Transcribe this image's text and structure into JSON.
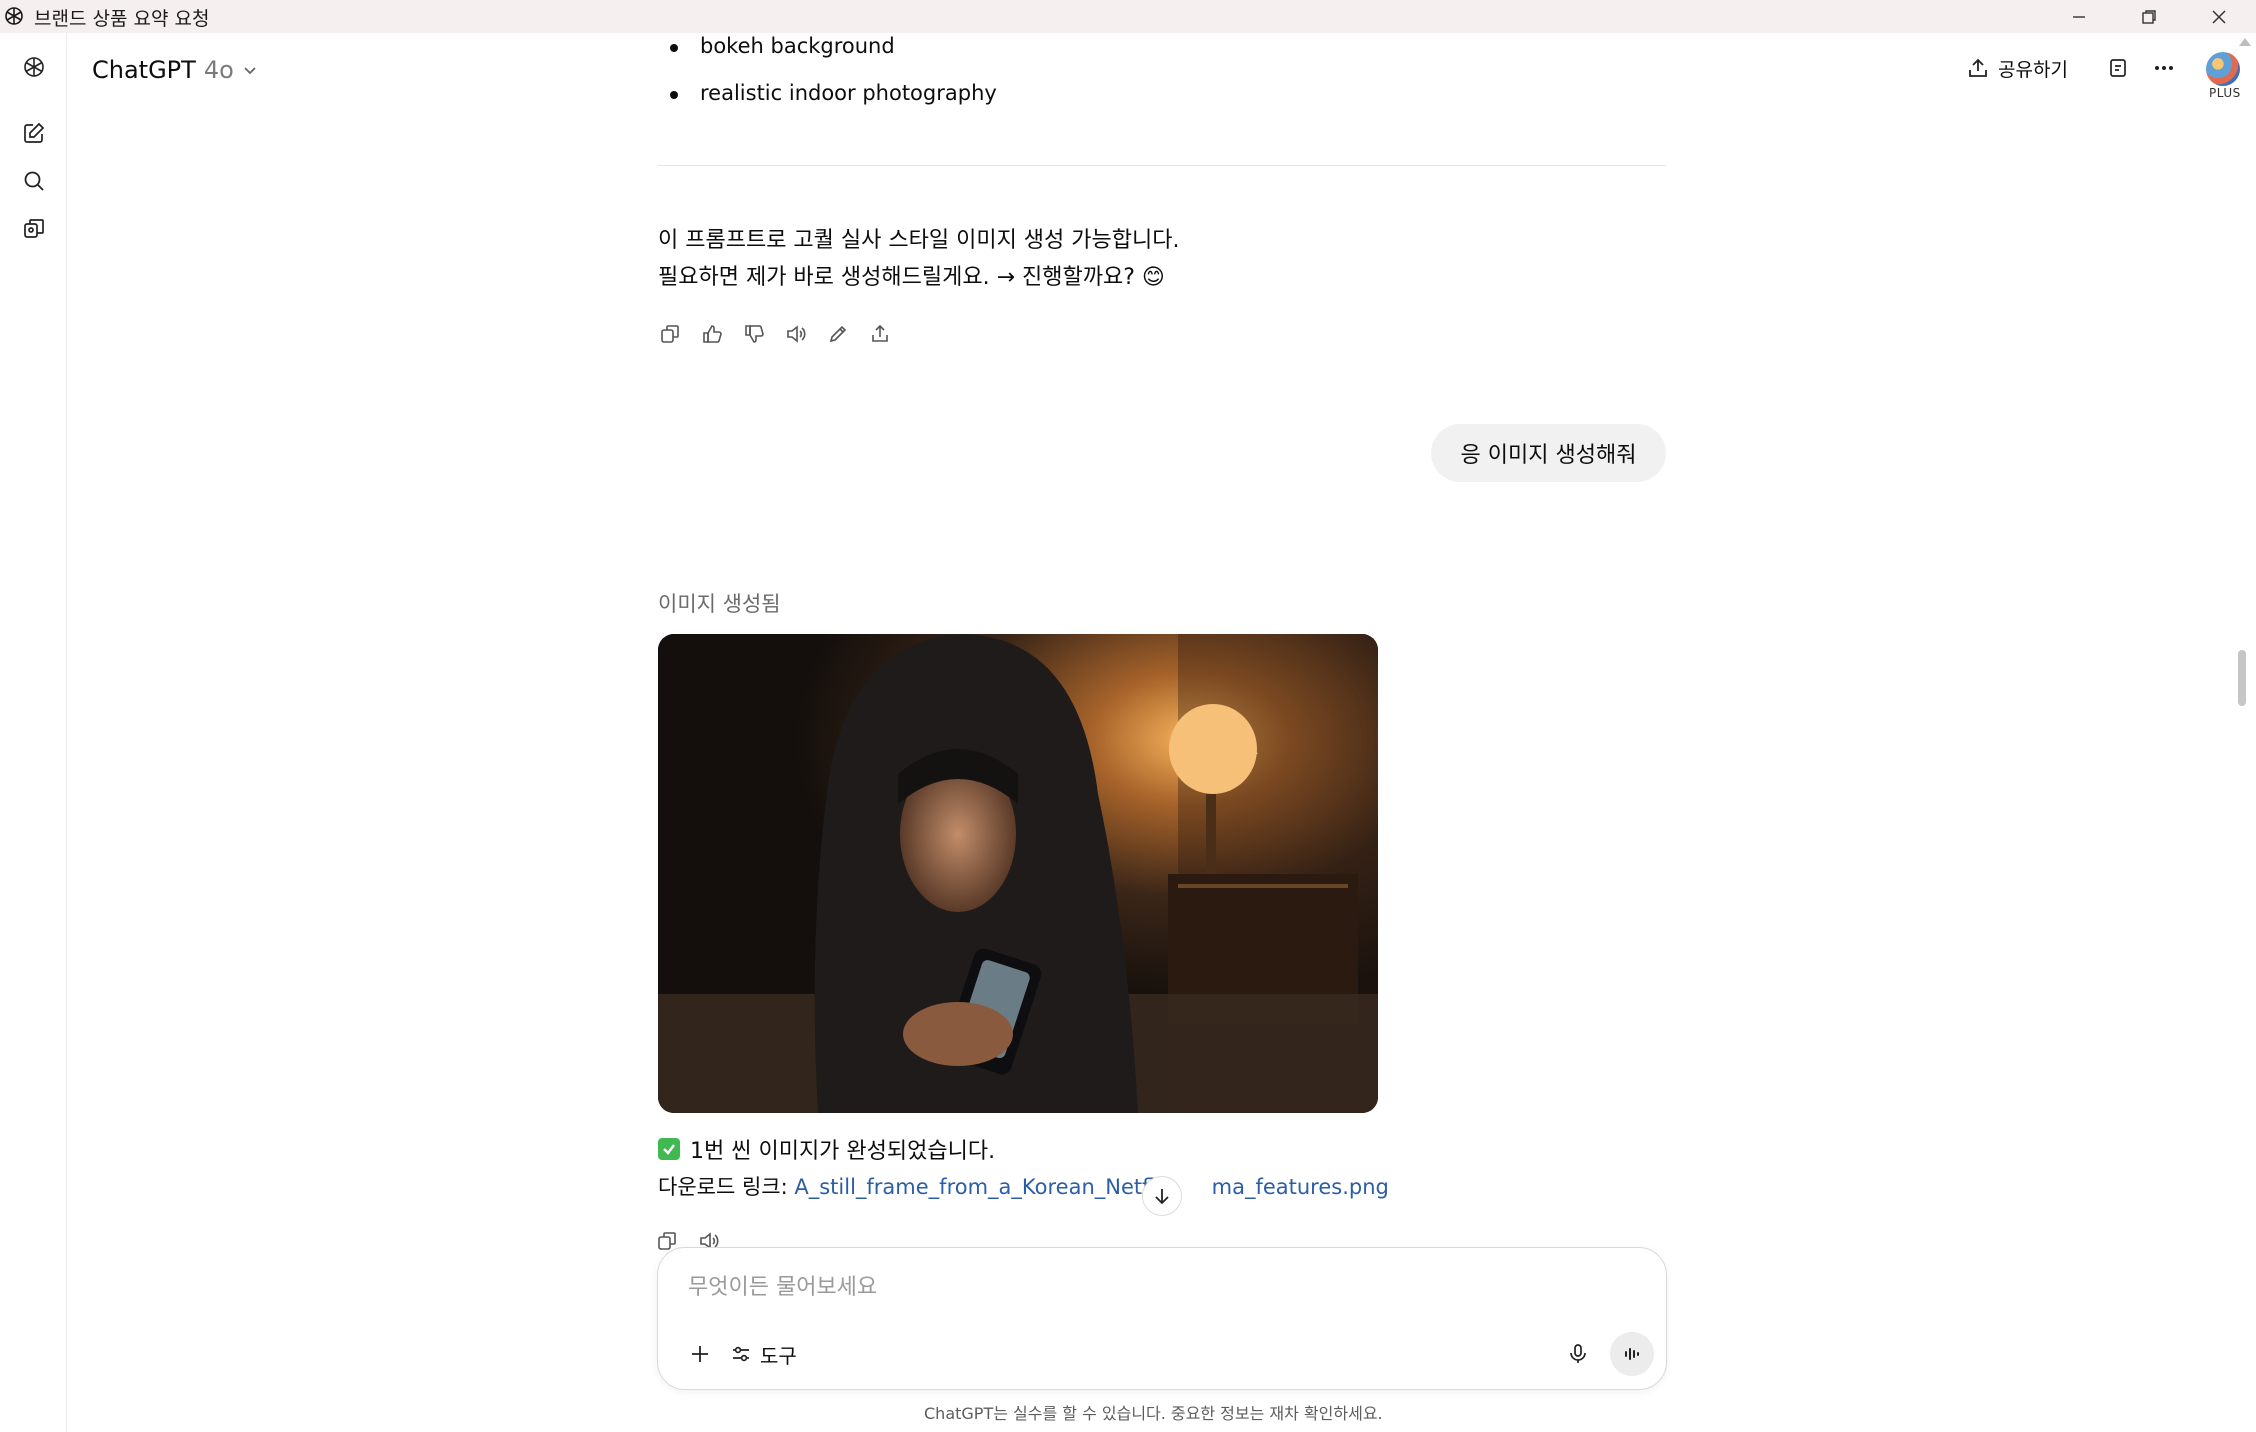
{
  "window": {
    "title": "브랜드 상품 요약 요청",
    "icons": [
      "chatgpt-logo-icon",
      "minimize-icon",
      "maximize-icon",
      "close-icon"
    ]
  },
  "sidebar": {
    "icons": [
      "chatgpt-logo-icon",
      "new-chat-icon",
      "search-icon",
      "library-icon"
    ]
  },
  "header": {
    "model_name": "ChatGPT",
    "model_version": "4o",
    "share_label": "공유하기",
    "plan_badge": "PLUS"
  },
  "conversation": {
    "bullets": [
      "bokeh background",
      "realistic indoor photography"
    ],
    "assistant_line1": "이 프롬프트로 고퀄 실사 스타일 이미지 생성 가능합니다.",
    "assistant_line2": "필요하면 제가 바로 생성해드릴게요. → 진행할까요? 😊",
    "action_icons": [
      "copy-icon",
      "thumbs-up-icon",
      "thumbs-down-icon",
      "read-aloud-icon",
      "edit-icon",
      "share-icon"
    ],
    "user_message": "응 이미지 생성해줘",
    "image_caption": "이미지 생성됨",
    "done_text": "1번 씬 이미지가 완성되었습니다.",
    "download_prefix": "다운로드 링크: ",
    "download_link_start": "A_still_frame_from_a_Korean_Netflix",
    "download_link_end": "ma_features.png"
  },
  "composer": {
    "placeholder": "무엇이든 물어보세요",
    "tools_label": "도구"
  },
  "footer": {
    "disclaimer": "ChatGPT는 실수를 할 수 있습니다. 중요한 정보는 재차 확인하세요."
  },
  "colors": {
    "titlebar_bg": "#f6eff0",
    "link": "#2b5ea7",
    "check_green": "#3fb950",
    "bubble_bg": "#f1f1f1"
  }
}
